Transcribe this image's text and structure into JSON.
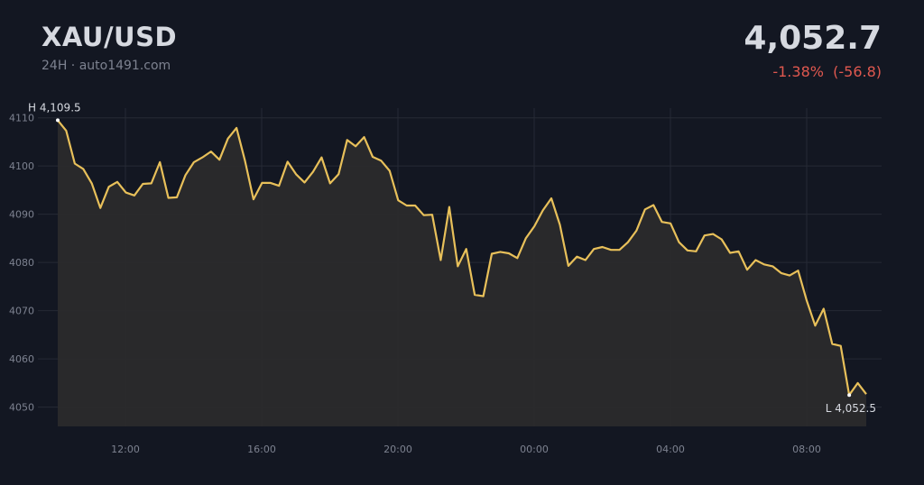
{
  "header": {
    "symbol": "XAU/USD",
    "subtitle": "24H · auto1491.com",
    "price": "4,052.7",
    "change_text": "-1.38%  (-56.8)"
  },
  "colors": {
    "background": "#131722",
    "line": "#e8c05a",
    "negative": "#e0584f",
    "text": "#d6d9e0",
    "muted": "#7d8290",
    "grid": "#262a35"
  },
  "chart_data": {
    "type": "area",
    "title": "",
    "xlabel": "",
    "ylabel": "",
    "ylim": [
      4046,
      4112
    ],
    "yticks": [
      4050,
      4060,
      4070,
      4080,
      4090,
      4100,
      4110
    ],
    "xticks": [
      "12:00",
      "16:00",
      "20:00",
      "00:00",
      "04:00",
      "08:00"
    ],
    "high_label": "H 4,109.5",
    "low_label": "L 4,052.5",
    "high": 4109.5,
    "low": 4052.5,
    "series": [
      {
        "values": [
          4109.5,
          4107.3,
          4100.5,
          4099.4,
          4096.4,
          4091.3,
          4095.7,
          4096.7,
          4094.5,
          4093.9,
          4096.3,
          4096.4,
          4100.8,
          4093.4,
          4093.5,
          4098.1,
          4100.8,
          4101.8,
          4103.0,
          4101.3,
          4105.7,
          4107.9,
          4101.1,
          4093.1,
          4096.5,
          4096.5,
          4095.9,
          4100.9,
          4098.3,
          4096.6,
          4098.8,
          4101.8,
          4096.4,
          4098.3,
          4105.4,
          4104.1,
          4106.0,
          4101.9,
          4101.1,
          4099.0,
          4092.9,
          4091.8,
          4091.8,
          4089.8,
          4089.9,
          4080.5,
          4091.5,
          4079.2,
          4082.8,
          4073.3,
          4073.0,
          4081.8,
          4082.2,
          4081.9,
          4080.9,
          4085.0,
          4087.5,
          4090.8,
          4093.3,
          4087.8,
          4079.3,
          4081.2,
          4080.5,
          4082.8,
          4083.2,
          4082.6,
          4082.6,
          4084.2,
          4086.6,
          4091.0,
          4091.9,
          4088.4,
          4088.1,
          4084.2,
          4082.5,
          4082.3,
          4085.6,
          4085.9,
          4084.8,
          4082.0,
          4082.3,
          4078.5,
          4080.5,
          4079.6,
          4079.2,
          4077.8,
          4077.3,
          4078.3,
          4072.1,
          4066.9,
          4070.4,
          4063.1,
          4062.7,
          4052.5,
          4055.0,
          4052.7
        ]
      }
    ]
  }
}
